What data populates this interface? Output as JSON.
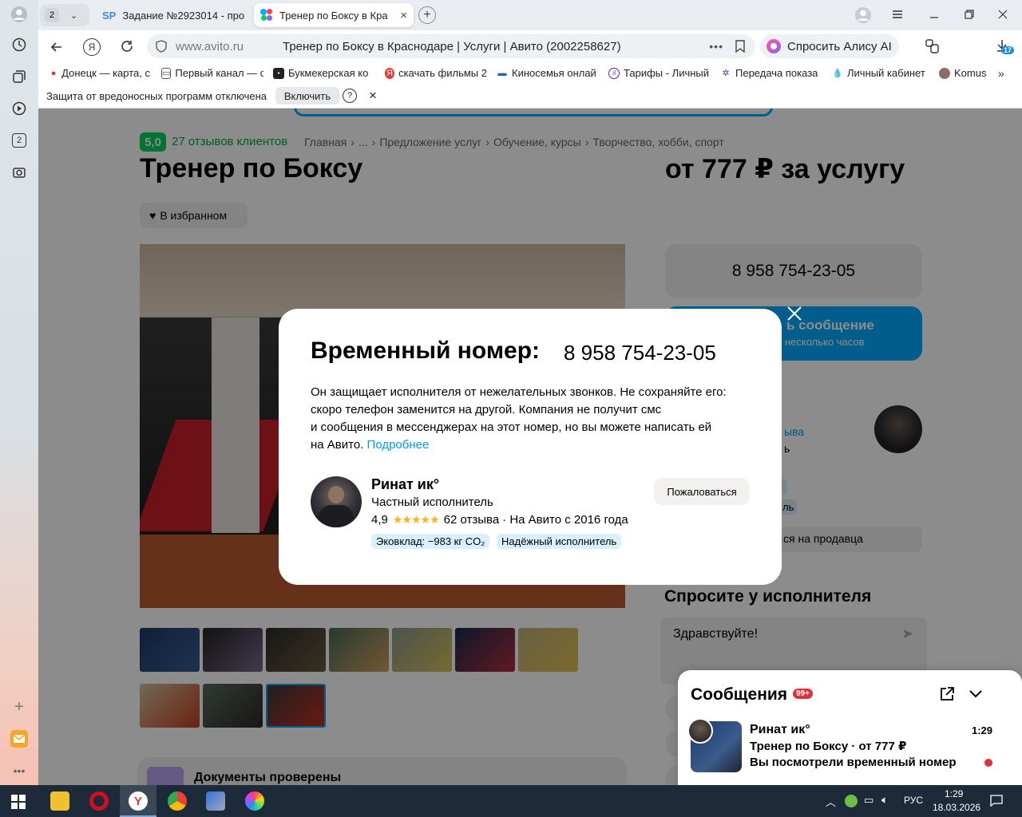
{
  "sidebar": {
    "badge_count": "2"
  },
  "tabs": [
    {
      "label": "Задание №2923014 - про",
      "icon": "sp"
    },
    {
      "label": "Тренер по Боксу в Кра",
      "icon": "avito"
    }
  ],
  "tab_counter": "2",
  "address": {
    "domain": "www.avito.ru",
    "title": "Тренер по Боксу в Краснодаре | Услуги | Авито (2002258627)"
  },
  "alice_button": "Спросить Алису AI",
  "downloads_badge": "17",
  "bookmarks": [
    "Донецк — карта, с",
    "Первый канал — с",
    "Букмекерская ко",
    "скачать фильмы 2",
    "Киносемья онлай",
    "Тарифы - Личный",
    "Передача показа",
    "Личный кабинет",
    "Komus"
  ],
  "infobar": {
    "text": "Защита от вредоносных программ отключена",
    "button": "Включить",
    "help": "?",
    "close": "×"
  },
  "listing": {
    "rating": "5,0",
    "reviews_link": "27 отзывов клиентов",
    "breadcrumb": [
      "Главная",
      "...",
      "Предложение услуг",
      "Обучение, курсы",
      "Творчество, хобби, спорт"
    ],
    "title": "Тренер по Боксу",
    "price": "от 777 ₽ за услугу",
    "favorite": "В избранном",
    "phone": "8 958 754-23-05",
    "message_btn": "ь сообщение",
    "message_sub": "несколько часов",
    "seller_link_partial": "ыва",
    "seller_text_partial": "ь",
    "badge_partial": "ль",
    "report_partial": "ся на продавца",
    "ask_title": "Спросите у исполнителя",
    "ask_placeholder": "Здравствуйте!",
    "docs_title": "Документы проверены"
  },
  "modal": {
    "title": "Временный номер:",
    "phone": "8 958 754-23-05",
    "description": "Он защищает исполнителя от нежелательных звонков. Не сохраняйте его: скоро телефон заменится на другой. Компания не получит смс и сообщения в мессенджерах на этот номер, но вы можете написать ей на Авито.",
    "desc_line1": "Он защищает исполнителя от нежелательных звонков. Не сохраняйте его:",
    "desc_line2": "скоро телефон заменится на другой. Компания не получит смс",
    "desc_line3": "и сообщения в мессенджерах на этот номер, но вы можете написать ей",
    "desc_line4": "на Авито.",
    "more_link": "Подробнее",
    "seller_name": "Ринат ик°",
    "seller_type": "Частный исполнитель",
    "seller_rating": "4,9",
    "seller_stars": 5,
    "seller_reviews": "62 отзыва",
    "seller_since": "· На Авито с 2016 года",
    "badge1": "Эковклад: −983 кг CO₂",
    "badge2": "Надёжный исполнитель",
    "report": "Пожаловаться"
  },
  "chat": {
    "title": "Сообщения",
    "badge": "99+",
    "sender": "Ринат ик°",
    "time": "1:29",
    "subject": "Тренер по Боксу · от 777 ₽",
    "preview": "Вы посмотрели временный номер"
  },
  "taskbar": {
    "lang": "РУС",
    "time": "1:29",
    "date": "18.03.2026"
  },
  "colors": {
    "avito_blue": "#00aaff",
    "green": "#02d15c",
    "star": "#ffb021",
    "link": "#0099f7",
    "badge_bg": "#d9f0ff",
    "red": "#e0303b"
  }
}
